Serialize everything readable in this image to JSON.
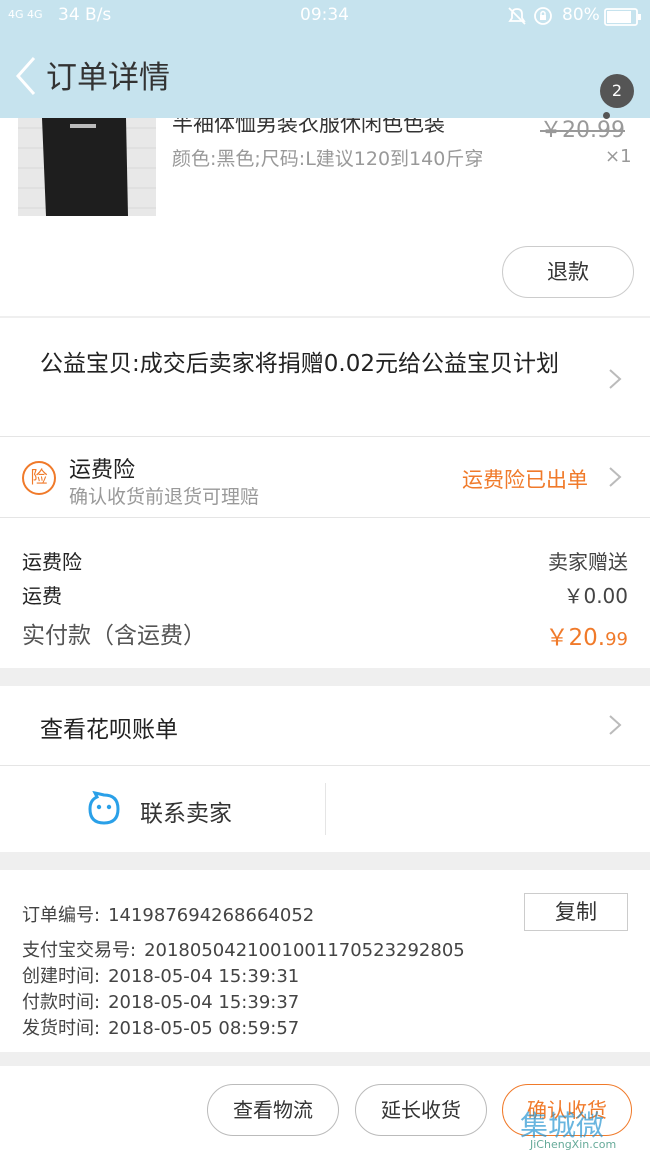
{
  "status_bar": {
    "network": "4G 4G",
    "speed": "34 B/s",
    "time": "09:34",
    "battery": "80%"
  },
  "header": {
    "title": "订单详情",
    "badge": "2"
  },
  "product": {
    "name": "半袖体恤男装衣服休闲色色装",
    "spec": "颜色:黑色;尺码:L建议120到140斤穿",
    "original_price": "￥20.99",
    "quantity": "×1",
    "refund_label": "退款"
  },
  "charity": {
    "text": "公益宝贝:成交后卖家将捐赠0.02元给公益宝贝计划"
  },
  "insurance": {
    "icon_text": "险",
    "title": "运费险",
    "subtitle": "确认收货前退货可理赔",
    "status": "运费险已出单"
  },
  "fees": {
    "items": [
      {
        "label": "运费险",
        "value": "卖家赠送"
      },
      {
        "label": "运费",
        "value": "￥0.00"
      }
    ],
    "total_label": "实付款（含运费）",
    "total_value_main": "￥20.",
    "total_value_cents": "99"
  },
  "links": {
    "huabei": "查看花呗账单",
    "contact_seller": "联系卖家"
  },
  "order_info": {
    "order_no_label": "订单编号:",
    "order_no": "141987694268664052",
    "copy_label": "复制",
    "alipay_label": "支付宝交易号:",
    "alipay_no": "2018050421001001170523292805",
    "created_label": "创建时间:",
    "created": "2018-05-04 15:39:31",
    "paid_label": "付款时间:",
    "paid": "2018-05-04 15:39:37",
    "shipped_label": "发货时间:",
    "shipped": "2018-05-05 08:59:57"
  },
  "footer": {
    "logistics": "查看物流",
    "extend": "延长收货",
    "confirm": "确认收货"
  },
  "watermark": {
    "main": "集城微",
    "url": "JiChengXin.com"
  },
  "colors": {
    "header_bg": "#c6e3ee",
    "accent_orange": "#f07a2a",
    "contact_blue": "#2aa0e8"
  }
}
